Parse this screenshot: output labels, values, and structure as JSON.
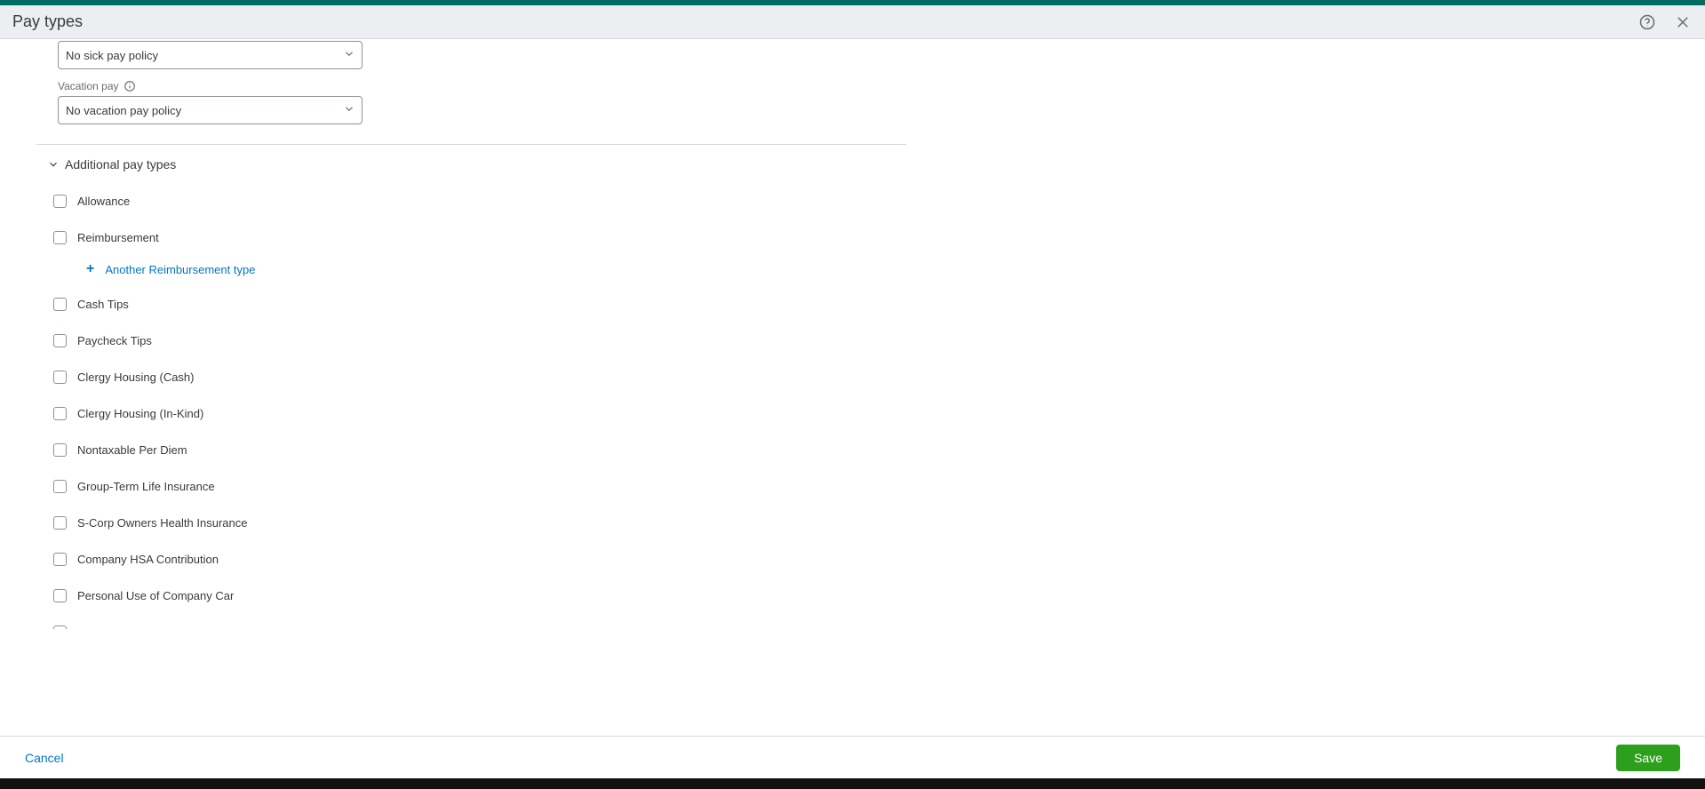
{
  "header": {
    "title": "Pay types"
  },
  "sickPay": {
    "value": "No sick pay policy"
  },
  "vacationPay": {
    "label": "Vacation pay",
    "value": "No vacation pay policy"
  },
  "section": {
    "title": "Additional pay types"
  },
  "payTypes": {
    "allowance": "Allowance",
    "reimbursement": "Reimbursement",
    "cashTips": "Cash Tips",
    "paycheckTips": "Paycheck Tips",
    "clergyCash": "Clergy Housing (Cash)",
    "clergyInKind": "Clergy Housing (In-Kind)",
    "nontaxPerDiem": "Nontaxable Per Diem",
    "groupTermLife": "Group-Term Life Insurance",
    "scorpHealth": "S-Corp Owners Health Insurance",
    "companyHsa": "Company HSA Contribution",
    "personalCar": "Personal Use of Company Car"
  },
  "addReimbursement": "Another Reimbursement type",
  "footer": {
    "cancel": "Cancel",
    "save": "Save"
  }
}
